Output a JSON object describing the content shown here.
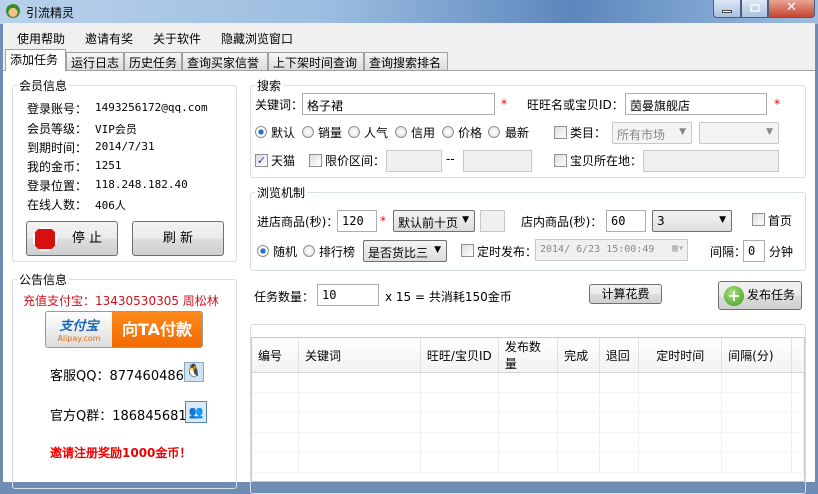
{
  "window": {
    "title": "引流精灵"
  },
  "menu": [
    "使用帮助",
    "邀请有奖",
    "关于软件",
    "隐藏浏览窗口"
  ],
  "tabs": [
    "添加任务",
    "运行日志",
    "历史任务",
    "查询买家信誉",
    "上下架时间查询",
    "查询搜索排名"
  ],
  "member": {
    "title": "会员信息",
    "rows": [
      {
        "label": "登录账号：",
        "value": "1493256172@qq.com"
      },
      {
        "label": "会员等级：",
        "value": "VIP会员"
      },
      {
        "label": "到期时间：",
        "value": "2014/7/31"
      },
      {
        "label": "我的金币：",
        "value": "1251"
      },
      {
        "label": "登录位置：",
        "value": "118.248.182.40"
      },
      {
        "label": "在线人数：",
        "value": "406人"
      }
    ],
    "stop_label": "停 止",
    "refresh_label": "刷 新"
  },
  "notice": {
    "title": "公告信息",
    "alipay_text": "充值支付宝：13430530305 周松林",
    "alipay_logo": "支付宝",
    "alipay_sub": "Alipay.com",
    "pay_label": "向TA付款",
    "qq": "客服QQ：877460486",
    "qgroup": "官方Q群：186845681",
    "invite": "邀请注册奖励1000金币！"
  },
  "search": {
    "title": "搜索",
    "keyword_label": "关键词：",
    "keyword": "格子裙",
    "shop_label": "旺旺名或宝贝ID：",
    "shop": "茵曼旗舰店",
    "sorts": [
      "默认",
      "销量",
      "人气",
      "信用",
      "价格",
      "最新"
    ],
    "sort_selected": 0,
    "category_label": "类目：",
    "category_value": "所有市场",
    "tmall_label": "天猫",
    "tmall_checked": true,
    "price_label": "限价区间：",
    "price_sep": "--",
    "location_label": "宝贝所在地："
  },
  "browse": {
    "title": "浏览机制",
    "enter_label": "进店商品(秒)：",
    "enter_value": "120",
    "pages_value": "默认前十页",
    "inner_label": "店内商品(秒)：",
    "inner_value": "60",
    "inner_count": "3",
    "home_label": "首页",
    "random_label": "随机",
    "rank_label": "排行榜",
    "compare_value": "是否货比三",
    "timed_label": "定时发布：",
    "timed_value": "2014/ 6/23 15:00:49",
    "interval_label": "间隔：",
    "interval_value": "0",
    "minute_label": "分钟"
  },
  "task": {
    "count_label": "任务数量：",
    "count_value": "10",
    "cost_text": "x 15 = 共消耗150金币",
    "calc_label": "计算花费",
    "publish_label": "发布任务"
  },
  "table": {
    "headers": [
      "编号",
      "关键词",
      "旺旺/宝贝ID",
      "发布数量",
      "完成",
      "退回",
      "定时时间",
      "间隔(分)"
    ]
  }
}
